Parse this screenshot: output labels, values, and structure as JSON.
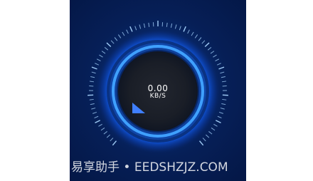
{
  "speed": {
    "value": "0.00",
    "unit": "KB/S",
    "level": 0
  },
  "watermark": {
    "text": "易享助手 • EEDSHZJZ.COM"
  },
  "colors": {
    "background": "#061f57",
    "ring_glow": "#1e73ff",
    "ring_core": "#3fa0ff",
    "tick": "#9fd0ff",
    "inner_disc": "#1b1f2a",
    "needle": "#3f7fff"
  },
  "icons": {
    "needle": "speed-needle-icon"
  }
}
